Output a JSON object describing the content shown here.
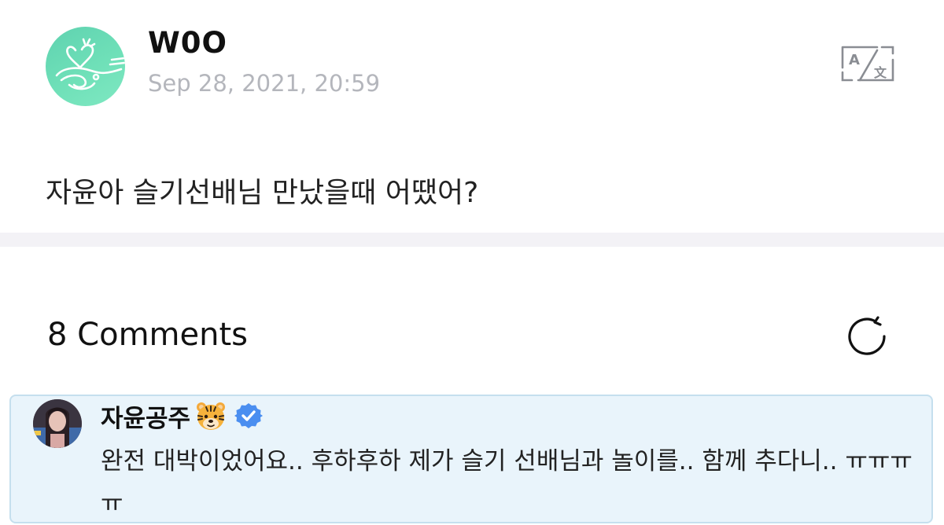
{
  "post": {
    "author": "W0O",
    "timestamp": "Sep 28, 2021, 20:59",
    "body": "자윤아 슬기선배님 만났을때 어땠어?",
    "avatar_icon": "heart-sketch-logo-icon",
    "avatar_color": "#6fe0b8",
    "translate_icon": "translate-icon"
  },
  "comments": {
    "header": "8 Comments",
    "refresh_icon": "refresh-icon",
    "items": [
      {
        "author": "자윤공주",
        "author_emoji_icon": "tiger-face-icon",
        "verified_icon": "verified-badge-icon",
        "text": "완전 대박이었어요.. 후하후하 제가 슬기 선배님과 놀이를.. 함께 추다니.. ㅠㅠㅠㅠ",
        "highlight_color": "#e9f4fb"
      }
    ]
  }
}
